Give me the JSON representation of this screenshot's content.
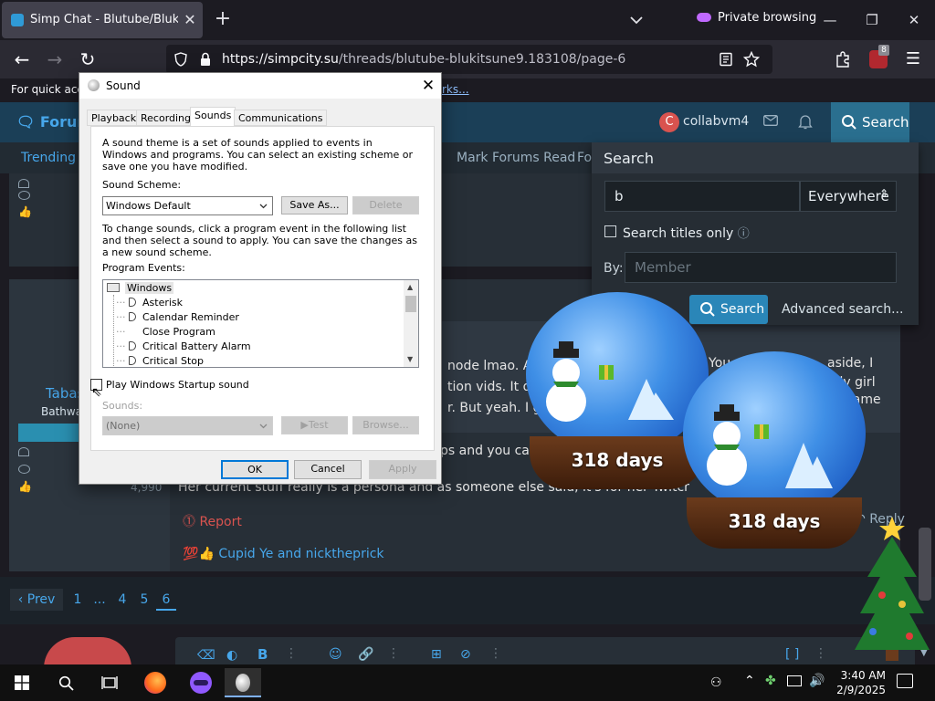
{
  "browser": {
    "tab_title": "Simp Chat - Blutube/Blukitsune",
    "private_label": "Private browsing",
    "url_host": "https://simpcity.su",
    "url_path": "/threads/blutube-blukitsune9.183108/page-6",
    "extension_badge": "8",
    "notice_text": "For quick acce",
    "notice_link": "rks..."
  },
  "forum": {
    "brand": "Forum",
    "user": "collabvm4",
    "avatar_letter": "C",
    "search_top": "Search",
    "nav_trending": "Trending",
    "nav_mark_read": "Mark Forums Read",
    "nav_fo": "Fo",
    "poster_name": "Tabas",
    "poster_sub": "Bathwa",
    "poster_badge": "S",
    "poster_count": "4,990",
    "post_lines": [
      "node lmao. As I",
      "tion vids. It doe",
      "r. But yeah. I gu"
    ],
    "post_right_lines": [
      "You",
      "aside, I",
      "girly girl",
      "rame"
    ],
    "post_mid": "ps and you can l",
    "post_line3": "Her current stuff really is a persona and as someone else said, it's for her Twitch simps",
    "report": "Report",
    "reply": "Reply",
    "reactions": "Cupid Ye and nicktheprick",
    "reaction_emoji": "💯",
    "pager": {
      "prev": "Prev",
      "pages": [
        "1",
        "...",
        "4",
        "5",
        "6"
      ],
      "current": "6"
    }
  },
  "search_panel": {
    "title": "Search",
    "query": "b",
    "scope": "Everywhere",
    "titles_only": "Search titles only",
    "by_label": "By:",
    "by_placeholder": "Member",
    "search_button": "Search",
    "advanced": "Advanced search..."
  },
  "globes": {
    "badge_text": "318 days"
  },
  "dialog": {
    "title": "Sound",
    "tabs": [
      "Playback",
      "Recording",
      "Sounds",
      "Communications"
    ],
    "active_tab": "Sounds",
    "intro": "A sound theme is a set of sounds applied to events in Windows and programs.  You can select an existing scheme or save one you have modified.",
    "scheme_label": "Sound Scheme:",
    "scheme_value": "Windows Default",
    "save_as": "Save As...",
    "delete": "Delete",
    "change_text": "To change sounds, click a program event in the following list and then select a sound to apply.  You can save the changes as a new sound scheme.",
    "events_label": "Program Events:",
    "events": [
      "Windows",
      "Asterisk",
      "Calendar Reminder",
      "Close Program",
      "Critical Battery Alarm",
      "Critical Stop"
    ],
    "startup_label": "Play Windows Startup sound",
    "sounds_label": "Sounds:",
    "sound_value": "(None)",
    "test": "Test",
    "browse": "Browse...",
    "ok": "OK",
    "cancel": "Cancel",
    "apply": "Apply"
  },
  "taskbar": {
    "time": "3:40 AM",
    "date": "2/9/2025"
  }
}
